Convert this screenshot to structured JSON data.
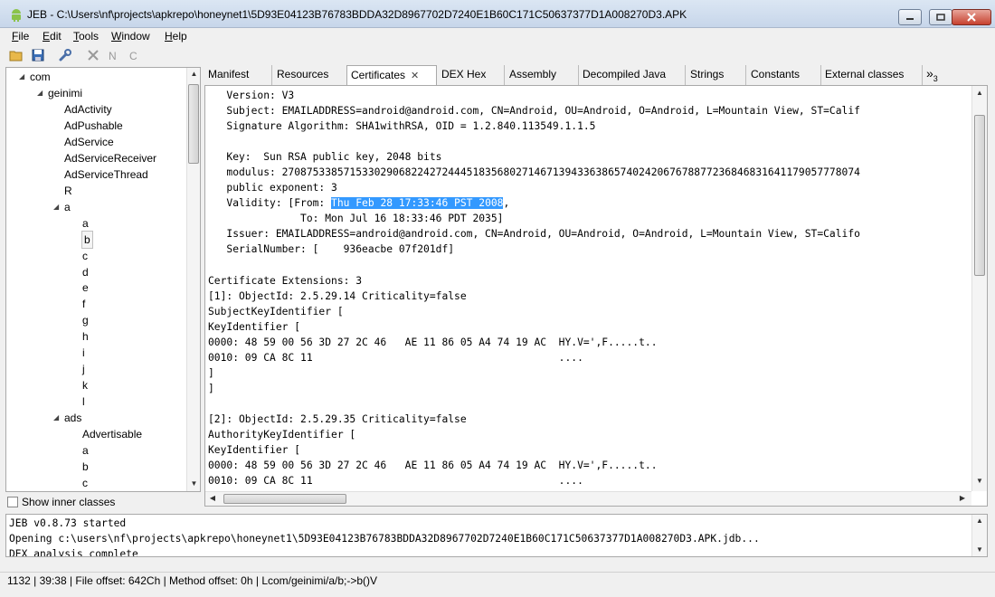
{
  "window": {
    "title": "JEB - C:\\Users\\nf\\projects\\apkrepo\\honeynet1\\5D93E04123B76783BDDA32D8967702D7240E1B60C171C50637377D1A008270D3.APK"
  },
  "menu": {
    "file": "ile",
    "file_u": "F",
    "edit": "dit",
    "edit_u": "E",
    "tools": "ools",
    "tools_u": "T",
    "window": "indow",
    "window_u": "W",
    "help": "elp",
    "help_u": "H"
  },
  "tree": {
    "rows": [
      {
        "label": "com",
        "toggle": "◢"
      },
      {
        "label": "geinimi",
        "toggle": "◢"
      },
      {
        "label": "AdActivity"
      },
      {
        "label": "AdPushable"
      },
      {
        "label": "AdService"
      },
      {
        "label": "AdServiceReceiver"
      },
      {
        "label": "AdServiceThread"
      },
      {
        "label": "R"
      },
      {
        "label": "a",
        "toggle": "◢"
      },
      {
        "label": "a"
      },
      {
        "label": "b"
      },
      {
        "label": "c"
      },
      {
        "label": "d"
      },
      {
        "label": "e"
      },
      {
        "label": "f"
      },
      {
        "label": "g"
      },
      {
        "label": "h"
      },
      {
        "label": "i"
      },
      {
        "label": "j"
      },
      {
        "label": "k"
      },
      {
        "label": "l"
      },
      {
        "label": "ads",
        "toggle": "◢"
      },
      {
        "label": "Advertisable"
      },
      {
        "label": "a"
      },
      {
        "label": "b"
      },
      {
        "label": "c"
      }
    ],
    "show_inner_classes": "Show inner classes",
    "show_inner_checked": false
  },
  "tabs": [
    {
      "label": "Manifest"
    },
    {
      "label": "Resources"
    },
    {
      "label": "Certificates",
      "active": true
    },
    {
      "label": "DEX Hex"
    },
    {
      "label": "Assembly"
    },
    {
      "label": "Decompiled Java"
    },
    {
      "label": "Strings"
    },
    {
      "label": "Constants"
    },
    {
      "label": "External classes"
    }
  ],
  "overflow_tabs": {
    "symbol": "»",
    "count": "3"
  },
  "certificate": {
    "lines": [
      "   Version: V3",
      "   Subject: EMAILADDRESS=android@android.com, CN=Android, OU=Android, O=Android, L=Mountain View, ST=Calif",
      "   Signature Algorithm: SHA1withRSA, OID = 1.2.840.113549.1.1.5",
      "",
      "   Key:  Sun RSA public key, 2048 bits",
      "   modulus: 2708753385715330290682242724445183568027146713943363865740242067678877236846831641179057778074",
      "   public exponent: 3",
      "VALIDITY",
      "               To: Mon Jul 16 18:33:46 PDT 2035]",
      "   Issuer: EMAILADDRESS=android@android.com, CN=Android, OU=Android, O=Android, L=Mountain View, ST=Califo",
      "   SerialNumber: [    936eacbe 07f201df]",
      "",
      "Certificate Extensions: 3",
      "[1]: ObjectId: 2.5.29.14 Criticality=false",
      "SubjectKeyIdentifier [",
      "KeyIdentifier [",
      "0000: 48 59 00 56 3D 27 2C 46   AE 11 86 05 A4 74 19 AC  HY.V=',F.....t..",
      "0010: 09 CA 8C 11                                        ....",
      "]",
      "]",
      "",
      "[2]: ObjectId: 2.5.29.35 Criticality=false",
      "AuthorityKeyIdentifier [",
      "KeyIdentifier [",
      "0000: 48 59 00 56 3D 27 2C 46   AE 11 86 05 A4 74 19 AC  HY.V=',F.....t..",
      "0010: 09 CA 8C 11                                        ...."
    ],
    "validity_prefix": "   Validity: [From: ",
    "validity_selected": "Thu Feb 28 17:33:46 PST 2008",
    "validity_suffix": ","
  },
  "console": {
    "lines": [
      "JEB v0.8.73 started",
      "Opening c:\\users\\nf\\projects\\apkrepo\\honeynet1\\5D93E04123B76783BDDA32D8967702D7240E1B60C171C50637377D1A008270D3.APK.jdb...",
      "DEX analysis complete"
    ]
  },
  "status": {
    "text": "1132  |  39:38  |  File offset: 642Ch  |  Method offset: 0h  |  Lcom/geinimi/a/b;->b()V"
  },
  "colors": {
    "selection": "#3399ff",
    "titlebar": "#c7d6ea",
    "close_button": "#c7412f"
  }
}
